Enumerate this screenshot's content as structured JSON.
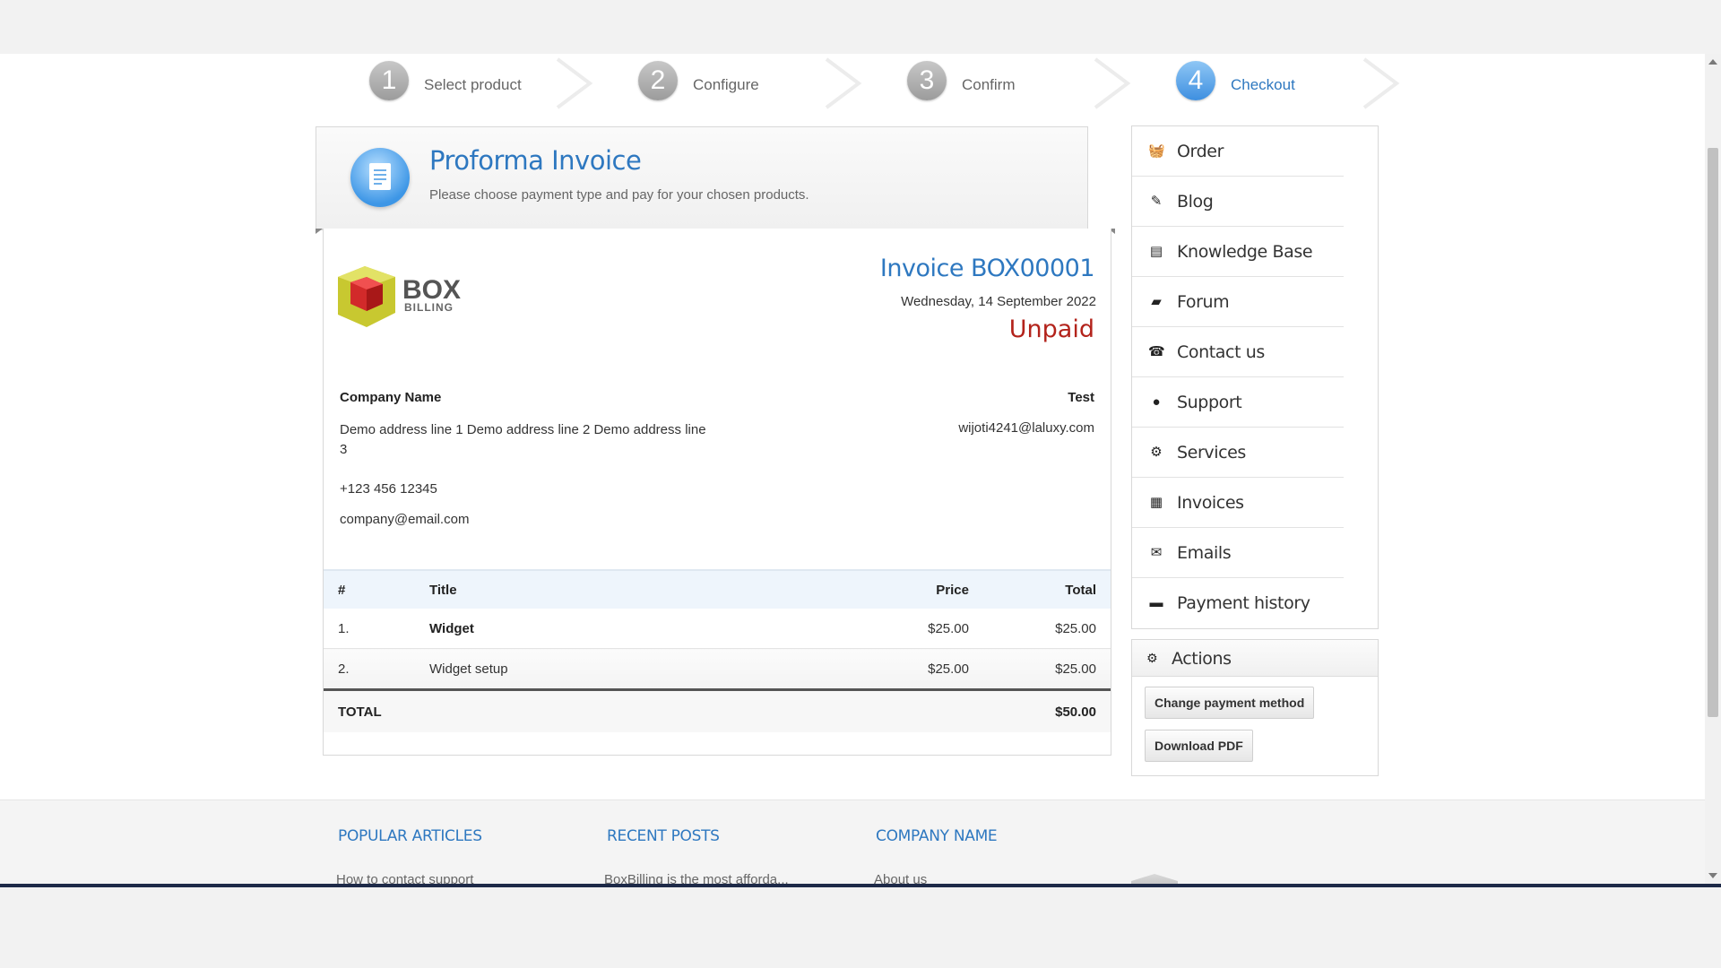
{
  "steps": [
    {
      "number": "1",
      "label": "Select product"
    },
    {
      "number": "2",
      "label": "Configure"
    },
    {
      "number": "3",
      "label": "Confirm"
    },
    {
      "number": "4",
      "label": "Checkout"
    }
  ],
  "header": {
    "title": "Proforma Invoice",
    "subtitle": "Please choose payment type and pay for your chosen products."
  },
  "invoice": {
    "logo_text": "BOX BILLING",
    "title": "Invoice BOX00001",
    "date": "Wednesday, 14 September 2022",
    "status": "Unpaid",
    "status_color": "#b3231b",
    "seller": {
      "name": "Company Name",
      "address": "Demo address line 1 Demo address line 2 Demo address line 3",
      "phone": "+123 456 12345",
      "email": "company@email.com"
    },
    "buyer": {
      "name": "Test",
      "email": "wijoti4241@laluxy.com"
    },
    "columns": [
      "#",
      "Title",
      "Price",
      "Total"
    ],
    "items": [
      {
        "num": "1.",
        "title": "Widget",
        "price": "$25.00",
        "total": "$25.00"
      },
      {
        "num": "2.",
        "title": "Widget setup",
        "price": "$25.00",
        "total": "$25.00"
      }
    ],
    "total_label": "TOTAL",
    "total_value": "$50.00"
  },
  "sidebar": {
    "items": [
      {
        "label": "Order",
        "icon": "basket-icon"
      },
      {
        "label": "Blog",
        "icon": "edit-icon"
      },
      {
        "label": "Knowledge Base",
        "icon": "book-icon"
      },
      {
        "label": "Forum",
        "icon": "chat-icon"
      },
      {
        "label": "Contact us",
        "icon": "phone-icon"
      },
      {
        "label": "Support",
        "icon": "user-support-icon"
      },
      {
        "label": "Services",
        "icon": "gears-icon"
      },
      {
        "label": "Invoices",
        "icon": "invoice-icon"
      },
      {
        "label": "Emails",
        "icon": "envelope-icon"
      },
      {
        "label": "Payment history",
        "icon": "money-icon"
      }
    ]
  },
  "actions": {
    "title": "Actions",
    "change_payment": "Change payment method",
    "download_pdf": "Download PDF"
  },
  "footer": {
    "popular_title": "POPULAR ARTICLES",
    "popular_link": "How to contact support",
    "recent_title": "RECENT POSTS",
    "recent_link": "BoxBilling is the most afforda...",
    "company_title": "COMPANY NAME",
    "company_link": "About us"
  },
  "colors": {
    "accent": "#2e78c0",
    "unpaid": "#b3231b"
  }
}
